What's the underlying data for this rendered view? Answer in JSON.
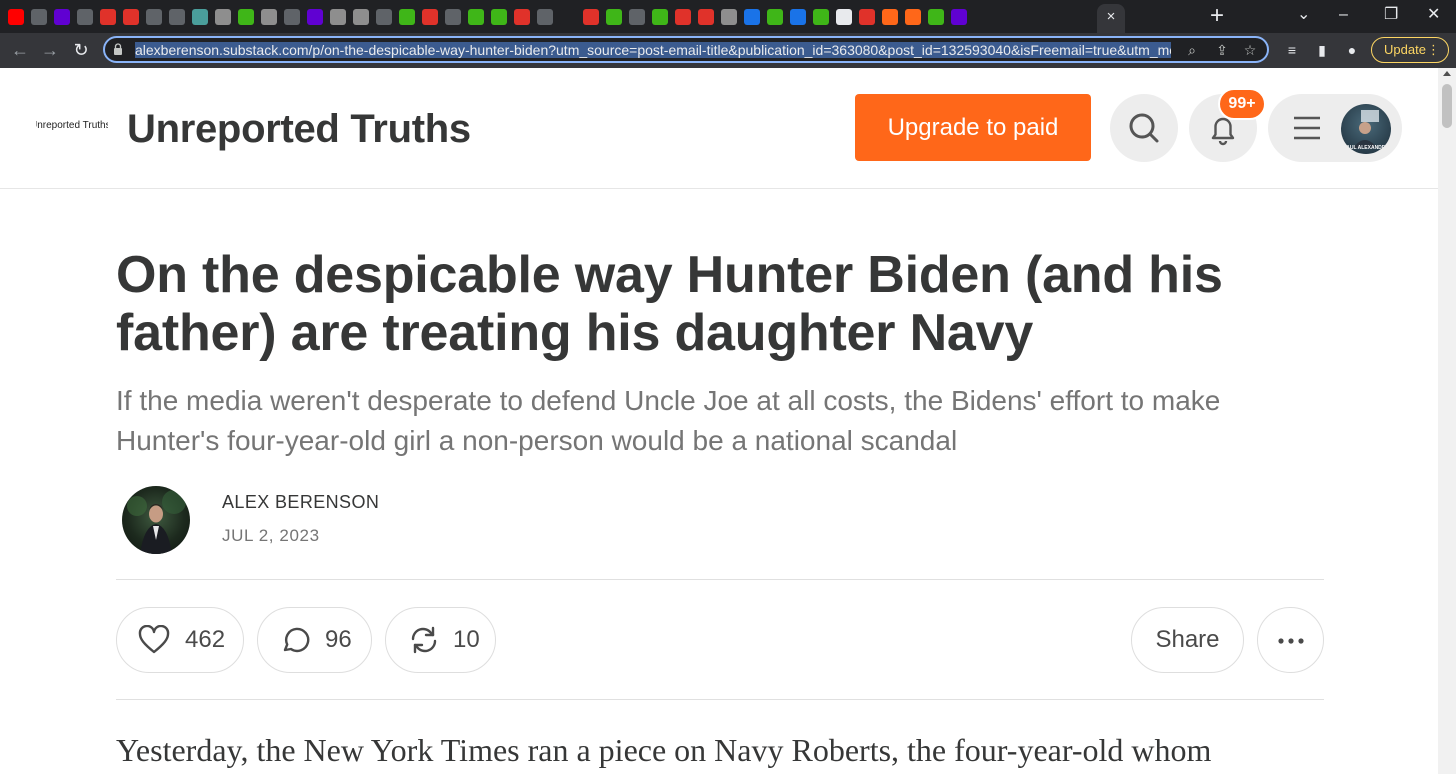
{
  "browser": {
    "url_display": "alexberenson.substack.com/p/on-the-despicable-way-hunter-biden?utm_source=post-email-title&publication_id=363080&post_id=132593040&isFreemail=true&utm_medium=e",
    "update_label": "Update",
    "active_tab_close": "×",
    "tab_favicons": [
      "#ff0000",
      "#5f6368",
      "#6001d2",
      "#5f6368",
      "#e0322a",
      "#e0322a",
      "#5f6368",
      "#5f6368",
      "#4a9e9b",
      "#8e8e8e",
      "#3fb618",
      "#8e8e8e",
      "#5f6368",
      "#6001d2",
      "#8e8e8e",
      "#8e8e8e",
      "#5f6368",
      "#3fb618",
      "#e0322a",
      "#5f6368",
      "#3fb618",
      "#3fb618",
      "#e0322a",
      "#5f6368",
      "#202124",
      "#e0322a",
      "#3fb618",
      "#5f6368",
      "#3fb618",
      "#e0322a",
      "#e0322a",
      "#8e8e8e",
      "#1a73e8",
      "#3fb618",
      "#1a73e8",
      "#3fb618",
      "#e8eaed",
      "#e0322a",
      "#ff6719",
      "#ff6719",
      "#3fb618",
      "#6001d2"
    ]
  },
  "site": {
    "logo_text": "Unreported Truths",
    "title": "Unreported Truths",
    "upgrade_label": "Upgrade to paid",
    "notification_count": "99+",
    "user_avatar_caption": "PAUL ALEXANDER"
  },
  "post": {
    "title": "On the despicable way Hunter Biden (and his father) are treating his daughter Navy",
    "subtitle": "If the media weren't desperate to defend Uncle Joe at all costs, the Bidens' effort to make Hunter's four-year-old girl a non-person would be a national scandal",
    "author": "ALEX BERENSON",
    "date": "JUL 2, 2023",
    "likes": "462",
    "comments": "96",
    "restacks": "10",
    "share_label": "Share",
    "body_first_line": "Yesterday, the New York Times ran a piece on Navy Roberts, the four-year-old whom"
  }
}
